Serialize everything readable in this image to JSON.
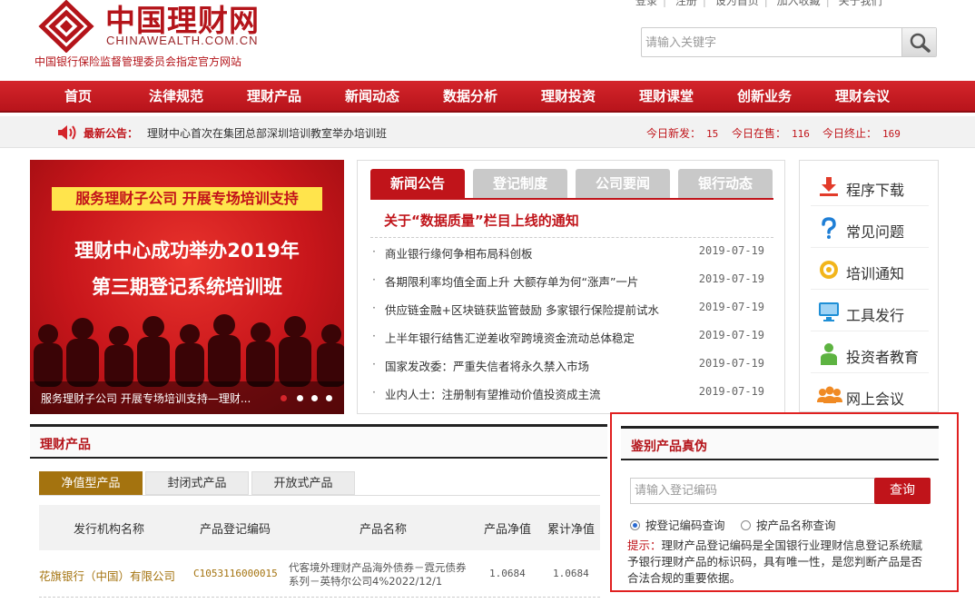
{
  "topbar": {
    "links": [
      "登录",
      "注册",
      "设为首页",
      "加入收藏",
      "关于我们"
    ]
  },
  "logo": {
    "cn": "中国理财网",
    "en": "CHINAWEALTH.COM.CN",
    "tagline": "中国银行保险监督管理委员会指定官方网站"
  },
  "search": {
    "placeholder": "请输入关键字"
  },
  "nav": [
    "首页",
    "法律规范",
    "理财产品",
    "新闻动态",
    "数据分析",
    "理财投资",
    "理财课堂",
    "创新业务",
    "理财会议"
  ],
  "notice": {
    "label": "最新公告：",
    "text": "理财中心首次在集团总部深圳培训教室举办培训班",
    "stats": [
      {
        "label": "今日新发：",
        "value": "15"
      },
      {
        "label": "今日在售：",
        "value": "116"
      },
      {
        "label": "今日终止：",
        "value": "169"
      }
    ]
  },
  "banner": {
    "tagline": "服务理财子公司 开展专场培训支持",
    "line1": "理财中心成功举办2019年",
    "line2": "第三期登记系统培训班",
    "caption": "服务理财子公司 开展专场培训支持—理财..."
  },
  "news": {
    "tabs": [
      "新闻公告",
      "登记制度",
      "公司要闻",
      "银行动态"
    ],
    "headline": "关于“数据质量”栏目上线的通知",
    "items": [
      {
        "title": "商业银行缘何争相布局科创板",
        "date": "2019-07-19"
      },
      {
        "title": "各期限利率均值全面上升 大额存单为何“涨声”一片",
        "date": "2019-07-19"
      },
      {
        "title": "供应链金融+区块链获监管鼓励 多家银行保险提前试水",
        "date": "2019-07-19"
      },
      {
        "title": "上半年银行结售汇逆差收窄跨境资金流动总体稳定",
        "date": "2019-07-19"
      },
      {
        "title": "国家发改委：严重失信者将永久禁入市场",
        "date": "2019-07-19"
      },
      {
        "title": "业内人士：注册制有望推动价值投资成主流",
        "date": "2019-07-19"
      }
    ]
  },
  "side": {
    "links": [
      {
        "label": "程序下载",
        "icon": "download-icon"
      },
      {
        "label": "常见问题",
        "icon": "question-icon"
      },
      {
        "label": "培训通知",
        "icon": "training-icon"
      },
      {
        "label": "工具发行",
        "icon": "monitor-icon"
      },
      {
        "label": "投资者教育",
        "icon": "investor-icon"
      },
      {
        "label": "网上会议",
        "icon": "meeting-icon"
      }
    ]
  },
  "products": {
    "title": "理财产品",
    "tabs": [
      "净值型产品",
      "封闭式产品",
      "开放式产品"
    ],
    "headers": [
      "发行机构名称",
      "产品登记编码",
      "产品名称",
      "产品净值",
      "累计净值"
    ],
    "rows": [
      {
        "issuer": "花旗银行（中国）有限公司",
        "code": "C1053116000015",
        "name1": "代客境外理财产品海外债券－霓元债券",
        "name2": "系列－英特尔公司4%2022/12/1",
        "nav": "1.0684",
        "cum": "1.0684"
      }
    ]
  },
  "verify": {
    "title": "鉴别产品真伪",
    "placeholder": "请输入登记编码",
    "button": "查询",
    "radio1": "按登记编码查询",
    "radio2": "按产品名称查询",
    "tip_label": "提示：",
    "tip_text": "理财产品登记编码是全国银行业理财信息登记系统赋予银行理财产品的标识码，具有唯一性，是您判断产品是否合法合规的重要依据。"
  },
  "colors": {
    "brand_red": "#c0141a",
    "gold": "#a4730f"
  }
}
